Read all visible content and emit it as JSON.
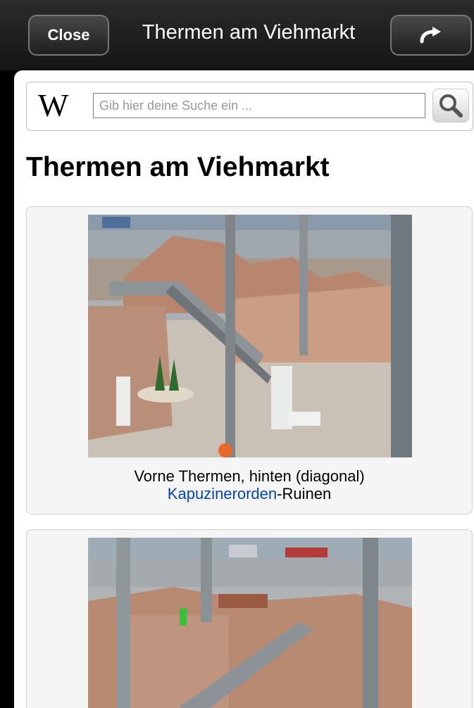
{
  "top_bar": {
    "close_label": "Close",
    "title": "Thermen am Viehmarkt",
    "forward_icon": "curved-arrow-forward-icon"
  },
  "search": {
    "logo_text": "W",
    "placeholder": "Gib hier deine Suche ein ...",
    "button_icon": "magnifier-icon"
  },
  "article": {
    "title": "Thermen am Viehmarkt",
    "figures": [
      {
        "caption_prefix": "Vorne Thermen, hinten (diagonal)",
        "caption_link": "Kapuzinerorden",
        "caption_suffix": "-Ruinen"
      }
    ]
  },
  "colors": {
    "link": "#0645ad",
    "bar_background": "#1c1c1c",
    "figure_background": "#f5f5f5"
  }
}
